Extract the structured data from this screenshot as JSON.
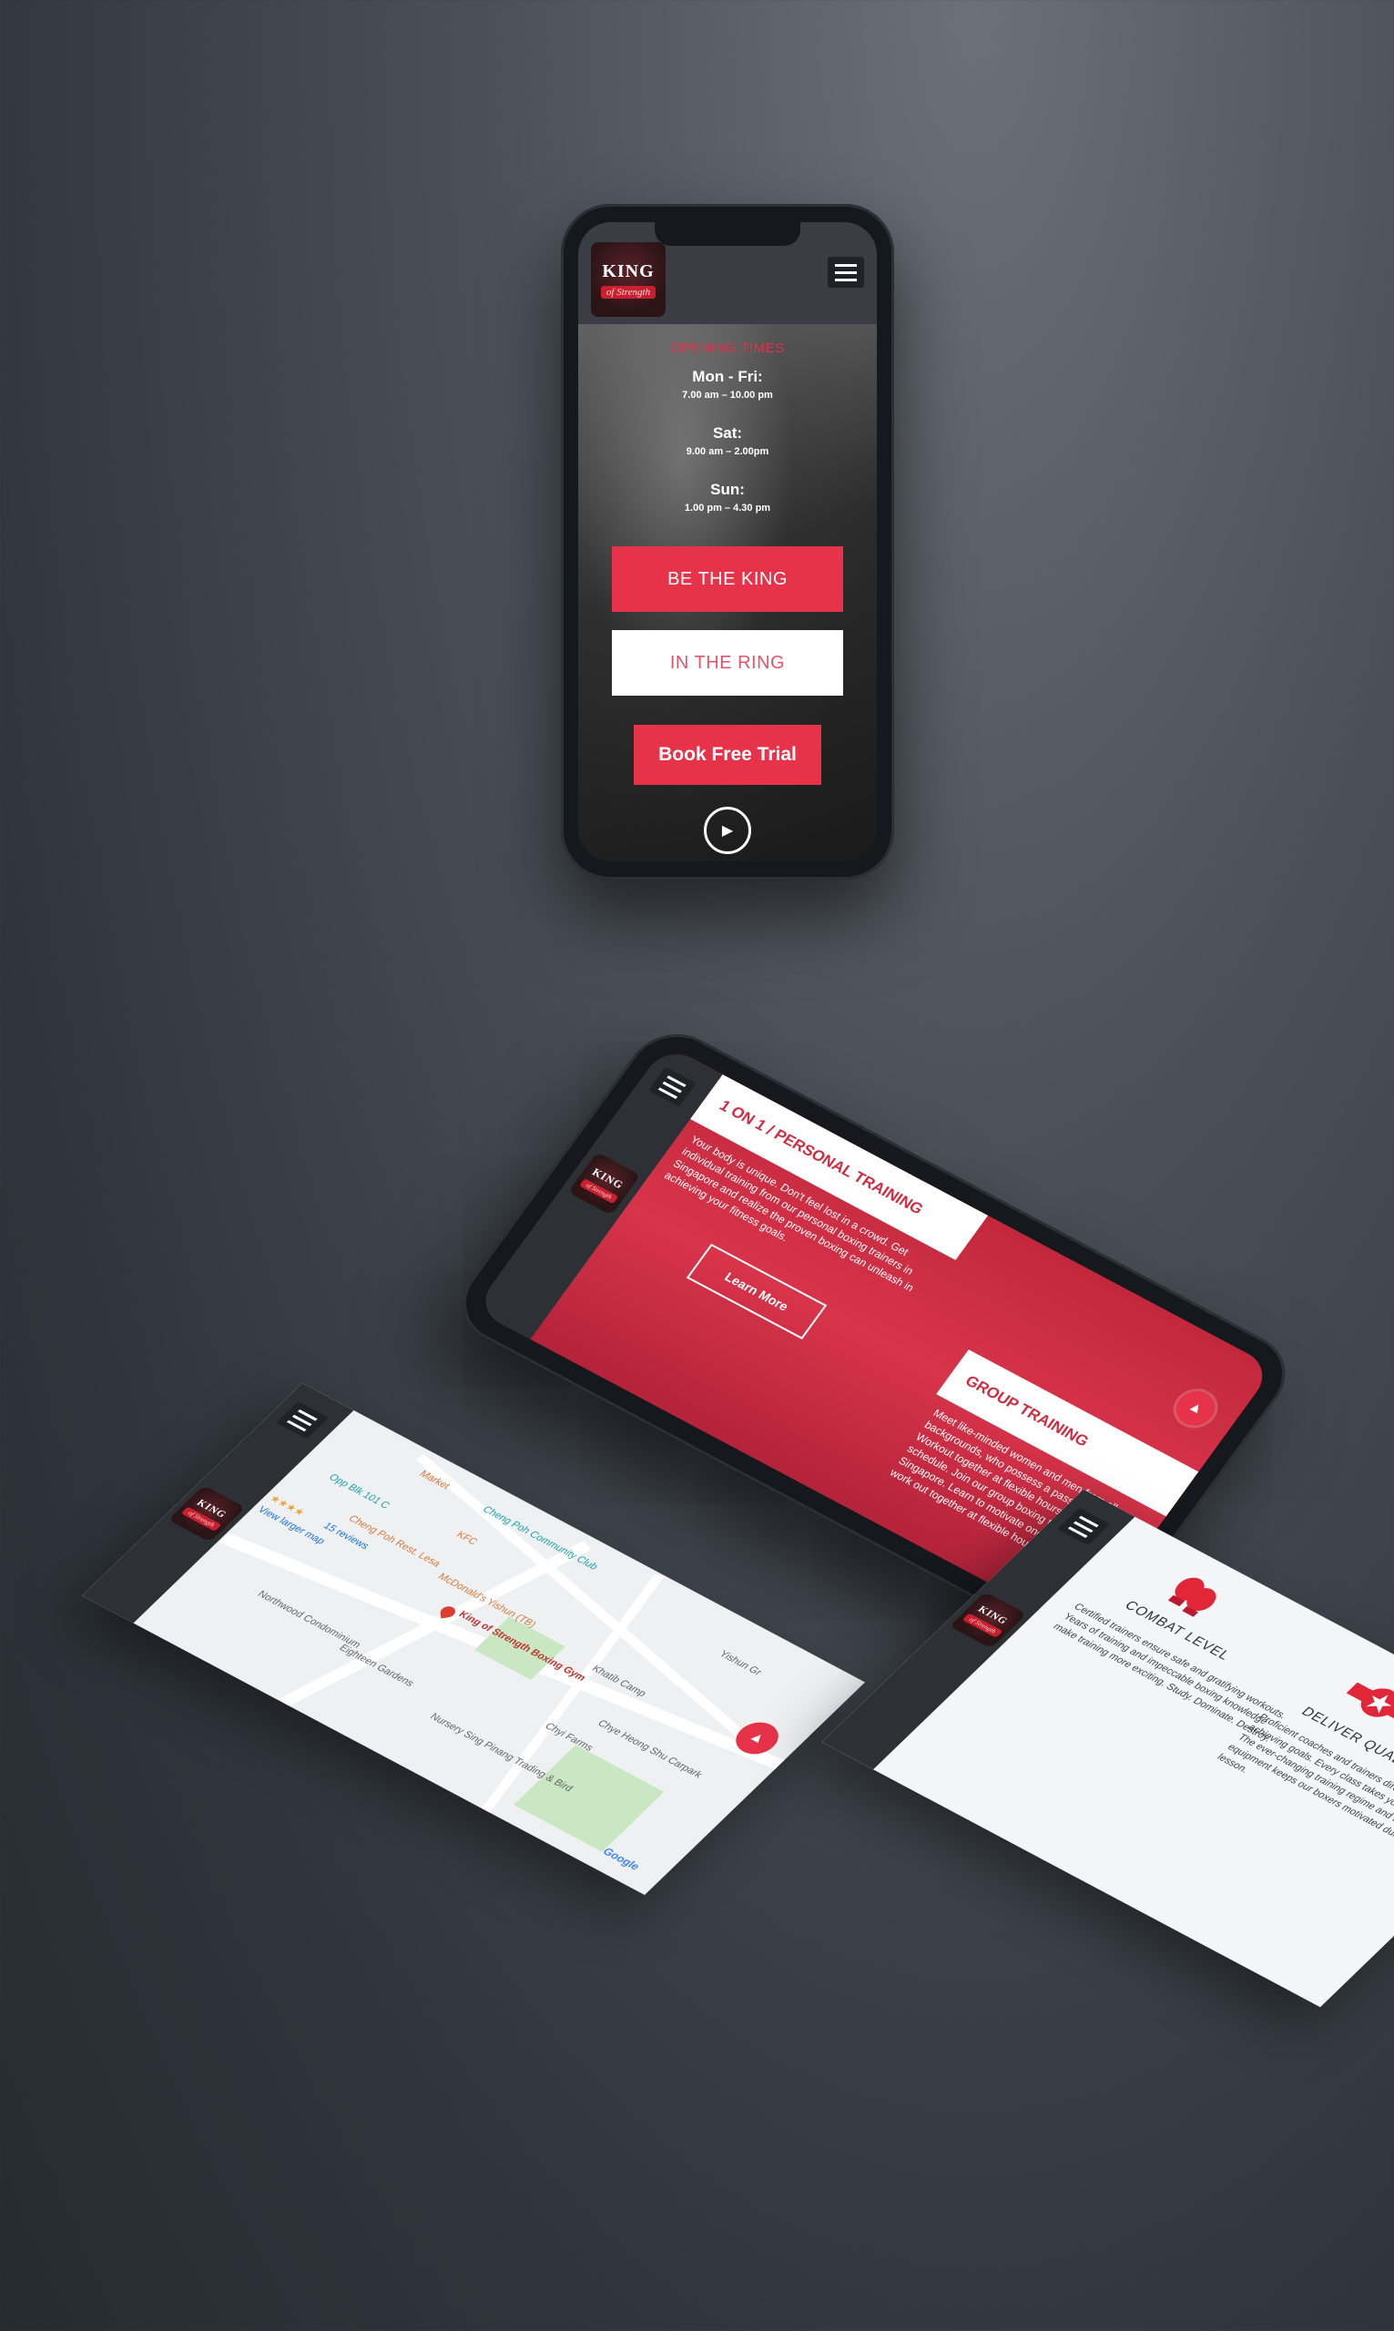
{
  "brand": {
    "logo_line1": "KING",
    "logo_line2": "of Strength",
    "accent": "#e7334a"
  },
  "hero": {
    "opening_label": "OPENING TIMES",
    "hours": [
      {
        "day": "Mon - Fri:",
        "time": "7.00 am – 10.00 pm"
      },
      {
        "day": "Sat:",
        "time": "9.00 am – 2.00pm"
      },
      {
        "day": "Sun:",
        "time": "1.00 pm – 4.30 pm"
      }
    ],
    "btn_king": "BE THE KING",
    "btn_ring": "IN THE RING",
    "btn_trial": "Book Free Trial"
  },
  "services": {
    "card1_title": "1 ON 1 / PERSONAL TRAINING",
    "card1_text": "Your body is unique. Don't feel lost in a crowd. Get individual training from our personal boxing trainers in Singapore and realize the proven boxing can unleash in achieving your fitness goals.",
    "learn_more": "Learn More",
    "card2_title": "GROUP TRAINING",
    "card2_text": "Meet like-minded women and men from all backgrounds, who possess a passion for boxing. Workout together at flexible hours that suit your schedule. Join our group boxing training in Singapore. Learn to motivate one another and work out together at flexible hours."
  },
  "map": {
    "labels": [
      "Market",
      "Cheng Poh Community Club",
      "Opp Blk 101 C",
      "KFC",
      "Cheng Poh Rest. Lesa",
      "McDonald's Yishun (TB)",
      "King of Strength Boxing Gym",
      "Khatib Camp",
      "Northwood Condominium",
      "Eighteen Gardens",
      "Nursery Sing Pinang Trading & Bird",
      "Chyi Farms",
      "Chye Heong Shu Carpark",
      "Yishun Gr"
    ],
    "stars": "★★★★",
    "reviews": "15 reviews",
    "larger_map": "View larger map",
    "google": "Google"
  },
  "features": {
    "f1_title": "COMBAT LEVEL",
    "f1_text": "Certified trainers ensure safe and gratifying workouts. Years of training and impeccable boxing knowledge make training more exciting. Study. Dominate. Destroy.",
    "f2_title": "DELIVER QUALITY",
    "f2_text": "Proficient coaches and trainers direct you towards achieving goals. Every class takes you a level ahead. The ever-changing training regime and modern equipment keeps our boxers motivated during each lesson."
  }
}
